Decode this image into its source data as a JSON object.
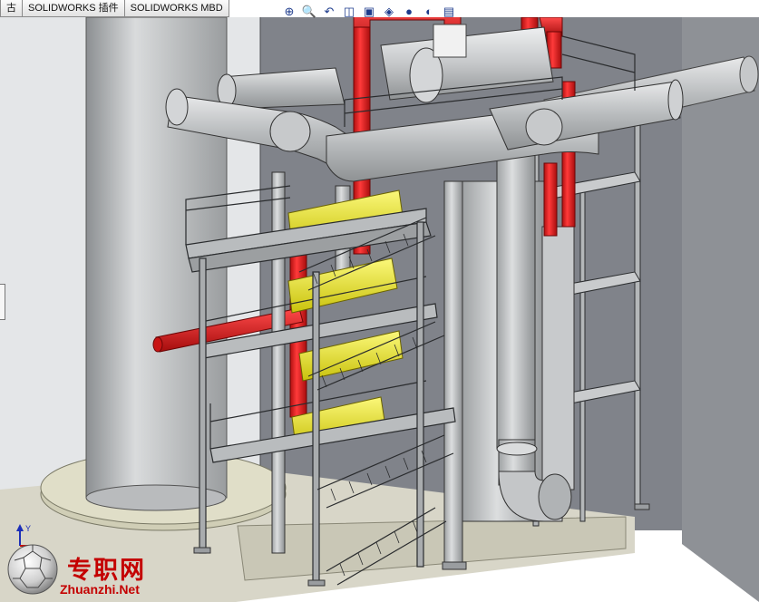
{
  "tabs": [
    {
      "label": "古"
    },
    {
      "label": "SOLIDWORKS 插件"
    },
    {
      "label": "SOLIDWORKS MBD"
    }
  ],
  "heads_up_toolbar": [
    {
      "icon": "zoom-to-fit-icon",
      "glyph": "⊕"
    },
    {
      "icon": "zoom-to-area-icon",
      "glyph": "🔍"
    },
    {
      "icon": "previous-view-icon",
      "glyph": "↶"
    },
    {
      "icon": "section-view-icon",
      "glyph": "◫"
    },
    {
      "icon": "view-orientation-icon",
      "glyph": "▣"
    },
    {
      "icon": "display-style-icon",
      "glyph": "◈"
    },
    {
      "icon": "appearance-icon",
      "glyph": "●"
    },
    {
      "icon": "scene-icon",
      "glyph": "◐"
    },
    {
      "icon": "view-settings-icon",
      "glyph": "▤"
    }
  ],
  "triad": {
    "axis_label": "Y"
  },
  "watermark": {
    "chinese": "专职网",
    "english": "Zhuanzhi.Net"
  },
  "colors": {
    "pipe_red": "#e11b1b",
    "steel_gray": "#a9acae",
    "equipment_yellow": "#e9e51a",
    "wall_dark": "#7e8184",
    "background": "#ffffff",
    "watermark_red": "#c40000"
  }
}
